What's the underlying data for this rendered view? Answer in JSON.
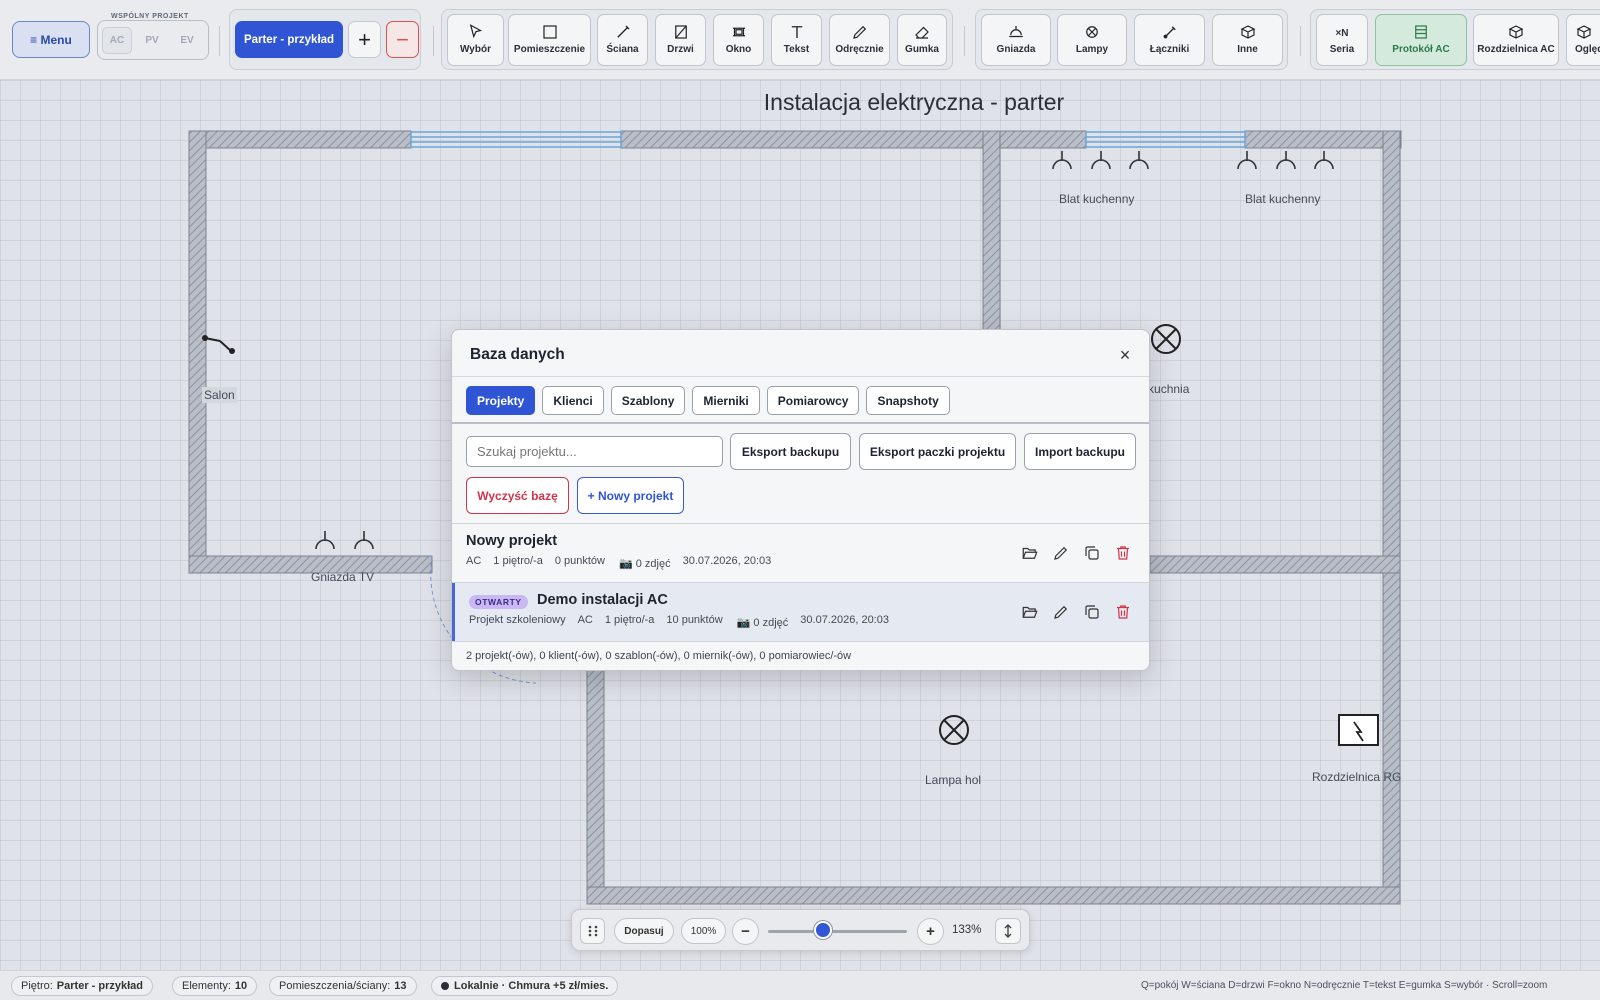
{
  "toolbar": {
    "menu_label": "≡ Menu",
    "shared_project_label": "WSPÓLNY PROJEKT",
    "modes": [
      "AC",
      "PV",
      "EV"
    ],
    "floor_label": "Parter - przykład",
    "add_floor": "+",
    "remove_floor": "−",
    "draw_tools": [
      {
        "label": "Wybór",
        "icon": "cursor-icon"
      },
      {
        "label": "Pomieszczenie",
        "icon": "room-icon"
      },
      {
        "label": "Ściana",
        "icon": "wall-icon"
      },
      {
        "label": "Drzwi",
        "icon": "door-icon"
      },
      {
        "label": "Okno",
        "icon": "window-icon"
      },
      {
        "label": "Tekst",
        "icon": "text-icon"
      },
      {
        "label": "Odręcznie",
        "icon": "pencil-icon"
      },
      {
        "label": "Gumka",
        "icon": "eraser-icon"
      }
    ],
    "device_tools": [
      {
        "label": "Gniazda",
        "icon": "socket-icon"
      },
      {
        "label": "Lampy",
        "icon": "lamp-icon"
      },
      {
        "label": "Łączniki",
        "icon": "switch-icon"
      },
      {
        "label": "Inne",
        "icon": "box-icon"
      }
    ],
    "extra_tools": [
      {
        "label": "Seria",
        "icon_text": "×N"
      },
      {
        "label": "Protokół AC",
        "icon": "table-icon"
      },
      {
        "label": "Rozdzielnica AC",
        "icon": "box-icon"
      },
      {
        "label": "Oględ",
        "icon": "box-icon"
      }
    ]
  },
  "canvas": {
    "title": "Instalacja elektryczna - parter",
    "labels": {
      "salon": "Salon",
      "blat1": "Blat kuchenny",
      "blat2": "Blat kuchenny",
      "lampa_kuchnia": "Lampa kuchnia",
      "gniazda_tv": "Gniazda TV",
      "lampa_hol": "Lampa hol",
      "rozdzielnica": "Rozdzielnica RG"
    }
  },
  "modal": {
    "title": "Baza danych",
    "close": "×",
    "tabs": [
      "Projekty",
      "Klienci",
      "Szablony",
      "Mierniki",
      "Pomiarowcy",
      "Snapshoty"
    ],
    "active_tab": "Projekty",
    "search_placeholder": "Szukaj projektu...",
    "buttons": {
      "export_backup": "Eksport backupu",
      "export_package": "Eksport paczki projektu",
      "import_backup": "Import backupu",
      "clear_db": "Wyczyść bazę",
      "new_project": "+ Nowy projekt"
    },
    "projects": [
      {
        "name": "Nowy projekt",
        "open": false,
        "description": "",
        "type": "AC",
        "floors": "1 piętro/-a",
        "points": "0 punktów",
        "photos": "📷 0 zdjęć",
        "date": "30.07.2026, 20:03"
      },
      {
        "name": "Demo instalacji AC",
        "open": true,
        "badge": "OTWARTY",
        "description": "Projekt szkoleniowy",
        "type": "AC",
        "floors": "1 piętro/-a",
        "points": "10 punktów",
        "photos": "📷 0 zdjęć",
        "date": "30.07.2026, 20:03"
      }
    ],
    "footer": "2 projekt(-ów), 0 klient(-ów), 0 szablon(-ów), 0 miernik(-ów), 0 pomiarowiec/-ów"
  },
  "zoombar": {
    "fit": "Dopasuj",
    "reset": "100%",
    "minus": "−",
    "plus": "+",
    "zoom_value": "133%",
    "zoom_level": 133,
    "zoom_range": [
      25,
      300
    ]
  },
  "statusbar": {
    "floor_label": "Piętro:",
    "floor_value": "Parter - przykład",
    "elements_label": "Elementy:",
    "elements_value": "10",
    "rooms_label": "Pomieszczenia/ściany:",
    "rooms_value": "13",
    "storage": "Lokalnie · Chmura +5 zł/mies.",
    "shortcuts": "Q=pokój W=ściana D=drzwi F=okno N=odręcznie T=tekst E=gumka S=wybór · Scroll=zoom"
  }
}
